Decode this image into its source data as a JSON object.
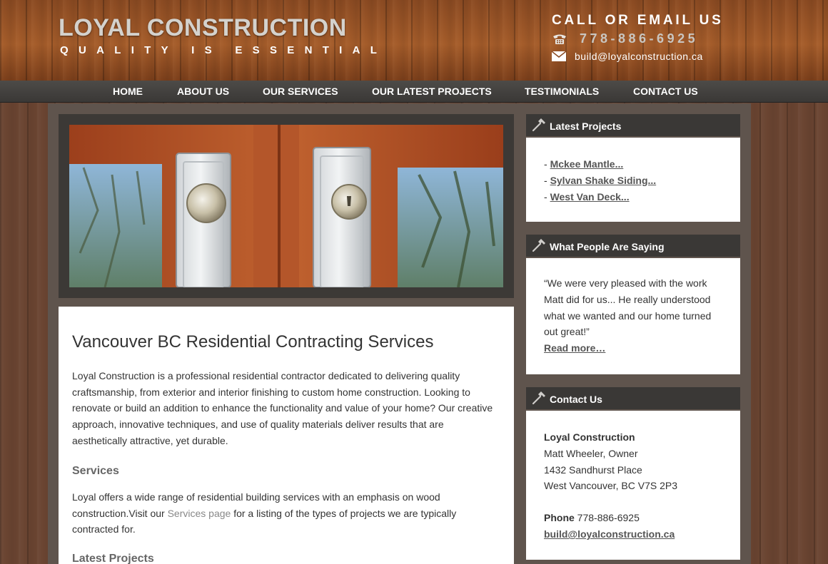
{
  "header": {
    "logo_title": "LOYAL CONSTRUCTION",
    "tagline": "QUALITY IS ESSENTIAL",
    "call_heading": "CALL OR EMAIL US",
    "phone": "778-886-6925",
    "email": "build@loyalconstruction.ca",
    "phone_icon": "phone-icon",
    "email_icon": "envelope-icon"
  },
  "nav": {
    "items": [
      {
        "label": "HOME"
      },
      {
        "label": "ABOUT US"
      },
      {
        "label": "OUR SERVICES"
      },
      {
        "label": "OUR LATEST PROJECTS"
      },
      {
        "label": "TESTIMONIALS"
      },
      {
        "label": "CONTACT US"
      }
    ]
  },
  "main": {
    "title": "Vancouver BC Residential Contracting Services",
    "intro": "Loyal Construction is a professional residential contractor dedicated to delivering quality craftsmanship, from exterior and interior finishing to custom home construction. Looking to renovate or build an addition to enhance the functionality and value of your home? Our creative approach, innovative techniques, and use of quality materials deliver results that are aesthetically attractive, yet durable.",
    "services_heading": "Services",
    "services_text_before": "Loyal offers a wide range of residential building services with an emphasis on wood construction.Visit our ",
    "services_link": "Services page",
    "services_text_after": " for a listing of the types of projects we are typically contracted for.",
    "latest_heading": "Latest Projects"
  },
  "sidebar": {
    "latest_projects": {
      "title": "Latest Projects",
      "items": [
        {
          "label": "Mckee Mantle..."
        },
        {
          "label": "Sylvan Shake Siding..."
        },
        {
          "label": "West Van Deck..."
        }
      ]
    },
    "testimonials": {
      "title": "What People Are Saying",
      "quote": "“We were very pleased with the work Matt did for us... He really understood what we wanted and our home turned out great!”",
      "read_more": "Read more…"
    },
    "contact": {
      "title": "Contact Us",
      "company": "Loyal Construction",
      "owner": "Matt Wheeler, Owner",
      "street": "1432 Sandhurst Place",
      "city": "West Vancouver, BC V7S 2P3",
      "phone_label": "Phone",
      "phone": "778-886-6925",
      "email": "build@loyalconstruction.ca"
    },
    "widget_icon": "hammer-icon"
  },
  "colors": {
    "nav_bg": "#3a3836",
    "wood": "#6a4431",
    "panel": "#5f544d"
  }
}
